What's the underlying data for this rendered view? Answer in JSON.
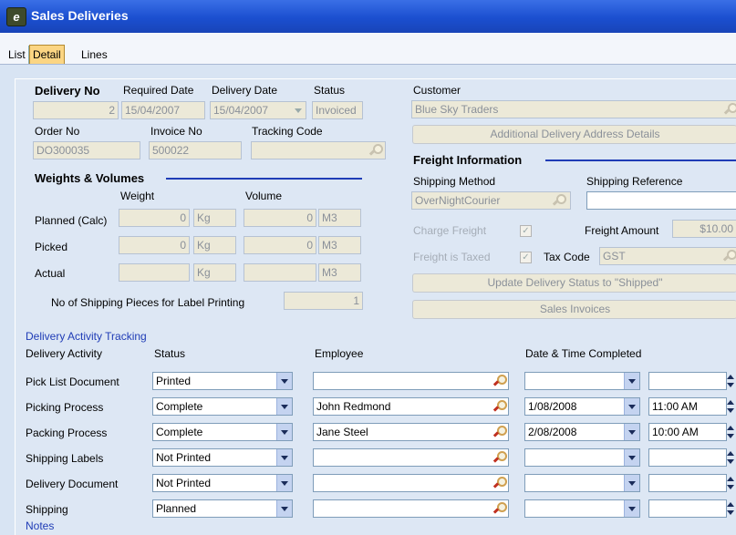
{
  "window": {
    "title": "Sales Deliveries",
    "app_icon_letter": "e"
  },
  "tabs": [
    "List",
    "Detail",
    "Lines"
  ],
  "header": {
    "delivery_no_label": "Delivery No",
    "delivery_no": "2",
    "required_date_label": "Required Date",
    "required_date": "15/04/2007",
    "delivery_date_label": "Delivery Date",
    "delivery_date": "15/04/2007",
    "status_label": "Status",
    "status": "Invoiced",
    "order_no_label": "Order No",
    "order_no": "DO300035",
    "invoice_no_label": "Invoice No",
    "invoice_no": "500022",
    "tracking_code_label": "Tracking Code",
    "tracking_code": ""
  },
  "weights": {
    "section_label": "Weights & Volumes",
    "weight_label": "Weight",
    "volume_label": "Volume",
    "rows": [
      {
        "label": "Planned (Calc)",
        "weight": "0",
        "weight_unit": "Kg",
        "volume": "0",
        "volume_unit": "M3"
      },
      {
        "label": "Picked",
        "weight": "0",
        "weight_unit": "Kg",
        "volume": "0",
        "volume_unit": "M3"
      },
      {
        "label": "Actual",
        "weight": "",
        "weight_unit": "Kg",
        "volume": "",
        "volume_unit": "M3"
      }
    ],
    "pieces_label": "No of Shipping Pieces for Label Printing",
    "pieces": "1"
  },
  "customer": {
    "label": "Customer",
    "value": "Blue Sky Traders",
    "address_button": "Additional Delivery Address Details"
  },
  "freight": {
    "section_label": "Freight Information",
    "shipping_method_label": "Shipping Method",
    "shipping_method": "OverNightCourier",
    "shipping_reference_label": "Shipping Reference",
    "shipping_reference": "",
    "charge_freight_label": "Charge Freight",
    "charge_freight_checked": true,
    "freight_amount_label": "Freight Amount",
    "freight_amount": "$10.00",
    "freight_taxed_label": "Freight is Taxed",
    "freight_taxed_checked": true,
    "tax_code_label": "Tax Code",
    "tax_code": "GST",
    "update_status_button": "Update Delivery Status to \"Shipped\"",
    "sales_invoices_button": "Sales Invoices"
  },
  "activity": {
    "section_label": "Delivery Activity Tracking",
    "columns": [
      "Delivery Activity",
      "Status",
      "Employee",
      "Date & Time Completed"
    ],
    "rows": [
      {
        "activity": "Pick List Document",
        "status": "Printed",
        "employee": "",
        "date": "",
        "time": ""
      },
      {
        "activity": "Picking Process",
        "status": "Complete",
        "employee": "John Redmond",
        "date": "1/08/2008",
        "time": "11:00 AM"
      },
      {
        "activity": "Packing Process",
        "status": "Complete",
        "employee": "Jane Steel",
        "date": "2/08/2008",
        "time": "10:00 AM"
      },
      {
        "activity": "Shipping Labels",
        "status": "Not Printed",
        "employee": "",
        "date": "",
        "time": ""
      },
      {
        "activity": "Delivery Document",
        "status": "Not Printed",
        "employee": "",
        "date": "",
        "time": ""
      },
      {
        "activity": "Shipping",
        "status": "Planned",
        "employee": "",
        "date": "",
        "time": ""
      }
    ]
  },
  "notes_label": "Notes",
  "icons": {
    "lookup": "magnifier-icon",
    "dropdown": "chevron-down-icon",
    "spin": "spin-icon"
  }
}
